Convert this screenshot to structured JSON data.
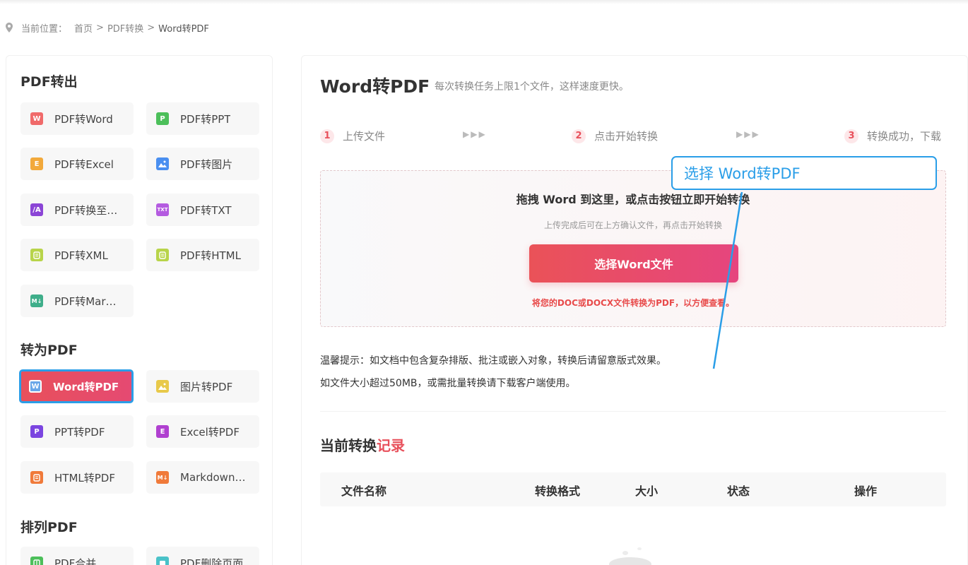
{
  "breadcrumb": {
    "prefix": "当前位置：",
    "items": [
      "首页",
      "PDF转换",
      "Word转PDF"
    ],
    "separator": ">"
  },
  "sidebar": {
    "sections": [
      {
        "title": "PDF转出",
        "items": [
          {
            "label": "PDF转Word",
            "icon": "W",
            "color": "#f06a6a"
          },
          {
            "label": "PDF转PPT",
            "icon": "P",
            "color": "#4cbf5a"
          },
          {
            "label": "PDF转Excel",
            "icon": "E",
            "color": "#f2a93b"
          },
          {
            "label": "PDF转图片",
            "icon": "image-icon",
            "color": "#4a8ff0"
          },
          {
            "label": "PDF转换至…",
            "icon": "/A",
            "color": "#8b45d6"
          },
          {
            "label": "PDF转TXT",
            "icon": "TXT",
            "color": "#b45be0"
          },
          {
            "label": "PDF转XML",
            "icon": "xml-icon",
            "color": "#b8d44a"
          },
          {
            "label": "PDF转HTML",
            "icon": "html-icon",
            "color": "#b8d44a"
          },
          {
            "label": "PDF转Mar…",
            "icon": "M↓",
            "color": "#3fae8a"
          }
        ]
      },
      {
        "title": "转为PDF",
        "items": [
          {
            "label": "Word转PDF",
            "icon": "W",
            "color": "#6aa7e8",
            "active": true
          },
          {
            "label": "图片转PDF",
            "icon": "image-icon",
            "color": "#e8c94a"
          },
          {
            "label": "PPT转PDF",
            "icon": "P",
            "color": "#7b45e0"
          },
          {
            "label": "Excel转PDF",
            "icon": "E",
            "color": "#b040d0"
          },
          {
            "label": "HTML转PDF",
            "icon": "html-icon",
            "color": "#f07a3a"
          },
          {
            "label": "Markdown…",
            "icon": "M↓",
            "color": "#f07a3a"
          }
        ]
      },
      {
        "title": "排列PDF",
        "items": [
          {
            "label": "PDF合并",
            "icon": "merge-icon",
            "color": "#4cbf5a"
          },
          {
            "label": "PDF删除页面",
            "icon": "delete-page-icon",
            "color": "#4ac2c8"
          }
        ]
      }
    ]
  },
  "main": {
    "title": "Word转PDF",
    "subtitle": "每次转换任务上限1个文件，这样速度更快。",
    "steps": [
      {
        "num": "1",
        "label": "上传文件"
      },
      {
        "num": "2",
        "label": "点击开始转换"
      },
      {
        "num": "3",
        "label": "转换成功，下载"
      }
    ],
    "step_arrows": "▶▶▶",
    "dropzone": {
      "title": "拖拽 Word 到这里，或点击按钮立即开始转换",
      "hint": "上传完成后可在上方确认文件，再点击开始转换",
      "button": "选择Word文件",
      "note": "将您的DOC或DOCX文件转换为PDF，以方便查看。"
    },
    "tips": [
      "温馨提示：如文档中包含复杂排版、批注或嵌入对象，转换后请留意版式效果。",
      "如文件大小超过50MB，或需批量转换请下载客户端使用。"
    ],
    "records": {
      "title_main": "当前转换",
      "title_highlight": "记录",
      "columns": [
        "文件名称",
        "转换格式",
        "大小",
        "状态",
        "操作"
      ]
    }
  },
  "callout": {
    "text": "选择 Word转PDF"
  },
  "colors": {
    "accent": "#e8505b",
    "callout_blue": "#2a9ee8"
  }
}
